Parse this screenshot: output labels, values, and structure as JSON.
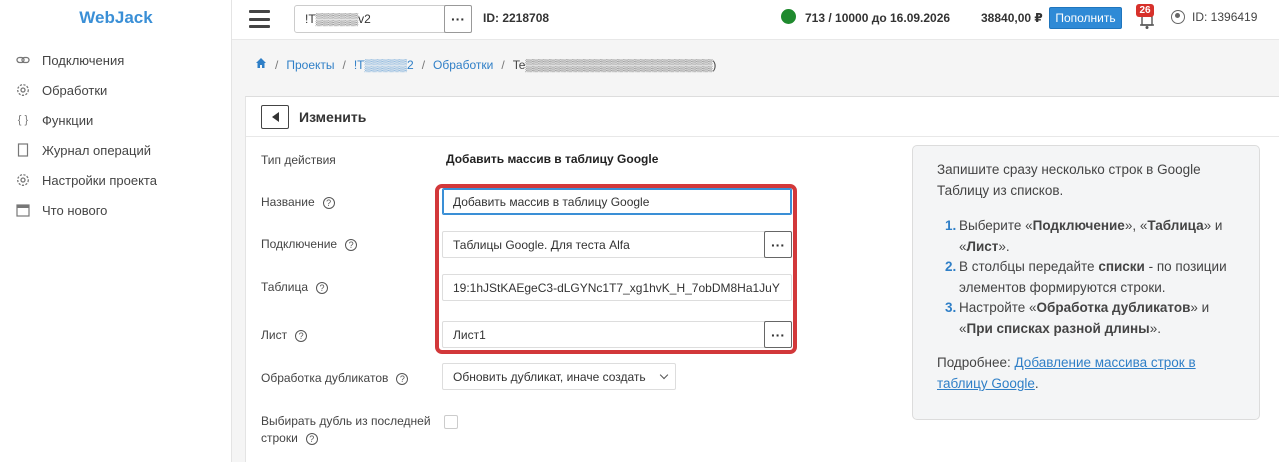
{
  "app": {
    "name": "WebJack"
  },
  "sidebar": {
    "items": [
      {
        "label": "Подключения",
        "icon": "link-icon"
      },
      {
        "label": "Обработки",
        "icon": "gear-icon"
      },
      {
        "label": "Функции",
        "icon": "braces-icon"
      },
      {
        "label": "Журнал операций",
        "icon": "journal-icon"
      },
      {
        "label": "Настройки проекта",
        "icon": "settings-icon"
      },
      {
        "label": "Что нового",
        "icon": "calendar-icon"
      }
    ]
  },
  "topbar": {
    "project_name": "!T▒▒▒▒▒v2",
    "project_id": "ID: 2218708",
    "quota": "713 / 10000 до 16.09.2026",
    "balance": "38840,00 ₽",
    "topup_label": "Пополнить",
    "notifications_count": "26",
    "user_id": "ID: 1396419",
    "status_color": "#1f8a2e"
  },
  "breadcrumb": {
    "items": [
      "Проекты",
      "!T▒▒▒▒▒2",
      "Обработки"
    ],
    "current": "Te▒▒▒▒▒▒▒▒▒▒▒▒▒▒▒▒▒▒▒▒▒▒)"
  },
  "card": {
    "title": "Изменить",
    "fields": {
      "action_type_label": "Тип действия",
      "action_type_value": "Добавить массив в таблицу Google",
      "name_label": "Название",
      "name_value": "Добавить массив в таблицу Google",
      "connection_label": "Подключение",
      "connection_value": "Таблицы Google. Для теста Alfa",
      "table_label": "Таблица",
      "table_value": "19:1hJStKAEgeC3-dLGYNc1T7_xg1hvK_H_7obDM8Ha1JuY",
      "sheet_label": "Лист",
      "sheet_value": "Лист1",
      "duplicates_label": "Обработка дубликатов",
      "duplicates_value": "Обновить дубликат, иначе создать",
      "last_dup_label_1": "Выбирать дубль из последней",
      "last_dup_label_2": "строки",
      "last_dup_checked": false
    }
  },
  "help": {
    "intro": "Запишите сразу несколько строк в Google Таблицу из списков.",
    "steps": [
      {
        "num": "1.",
        "parts": [
          "Выберите «",
          "Подключение",
          "», «",
          "Таблица",
          "» и «",
          "Лист",
          "»."
        ]
      },
      {
        "num": "2.",
        "parts": [
          "В столбцы передайте ",
          "списки",
          " - по позиции элементов формируются строки."
        ]
      },
      {
        "num": "3.",
        "parts": [
          "Настройте «",
          "Обработка дубликатов",
          "» и «",
          "При списках разной длины",
          "»."
        ]
      }
    ],
    "more_prefix": "Подробнее: ",
    "more_link": "Добавление массива строк в таблицу Google",
    "more_suffix": "."
  },
  "colors": {
    "accent": "#2f7fc7",
    "highlight": "#d2383a",
    "badge": "#d7312b"
  }
}
